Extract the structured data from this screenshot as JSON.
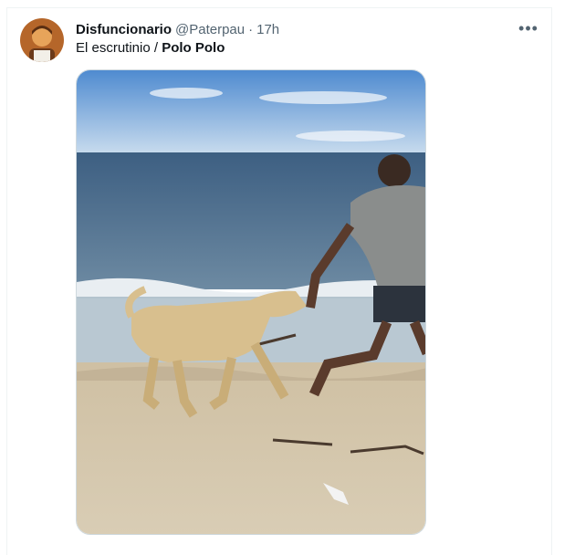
{
  "tweet": {
    "author_name": "Disfuncionario",
    "author_handle": "@Paterpau",
    "separator": "·",
    "time": "17h",
    "text_plain": "El escrutinio / ",
    "text_bold": "Polo Polo",
    "more_icon": "more-horizontal-icon",
    "more_label": "•••"
  },
  "colors": {
    "text_primary": "#0f1419",
    "text_secondary": "#536471",
    "border": "#cfd9de"
  }
}
